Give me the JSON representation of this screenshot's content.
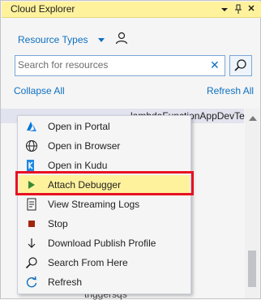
{
  "window": {
    "title": "Cloud Explorer",
    "controls": {
      "dropdown_icon": "dropdown-arrow-icon",
      "pin_icon": "pin-icon",
      "close_icon": "close-icon"
    }
  },
  "toolbar": {
    "resource_types_label": "Resource Types",
    "account_icon": "person-icon"
  },
  "search": {
    "placeholder": "Search for resources",
    "value": ""
  },
  "links": {
    "collapse_all": "Collapse All",
    "refresh_all": "Refresh All"
  },
  "tree": {
    "selected_item_label": "...lambdaFunctionAppDevTest",
    "bottom_item_label": "triggersqs"
  },
  "context_menu": {
    "items": [
      {
        "label": "Open in Portal",
        "icon": "azure-logo-icon",
        "highlighted": false
      },
      {
        "label": "Open in Browser",
        "icon": "globe-icon",
        "highlighted": false
      },
      {
        "label": "Open in Kudu",
        "icon": "kudu-icon",
        "highlighted": false
      },
      {
        "label": "Attach Debugger",
        "icon": "play-icon",
        "highlighted": true
      },
      {
        "label": "View Streaming Logs",
        "icon": "log-document-icon",
        "highlighted": false
      },
      {
        "label": "Stop",
        "icon": "stop-icon",
        "highlighted": false
      },
      {
        "label": "Download Publish Profile",
        "icon": "download-icon",
        "highlighted": false
      },
      {
        "label": "Search From Here",
        "icon": "search-icon",
        "highlighted": false
      },
      {
        "label": "Refresh",
        "icon": "refresh-icon",
        "highlighted": false
      }
    ]
  },
  "colors": {
    "accent": "#0E70C0",
    "title_bar": "#FFF29D",
    "highlight_border": "#E81123",
    "play_green": "#388A34",
    "stop_red": "#A1260D"
  }
}
